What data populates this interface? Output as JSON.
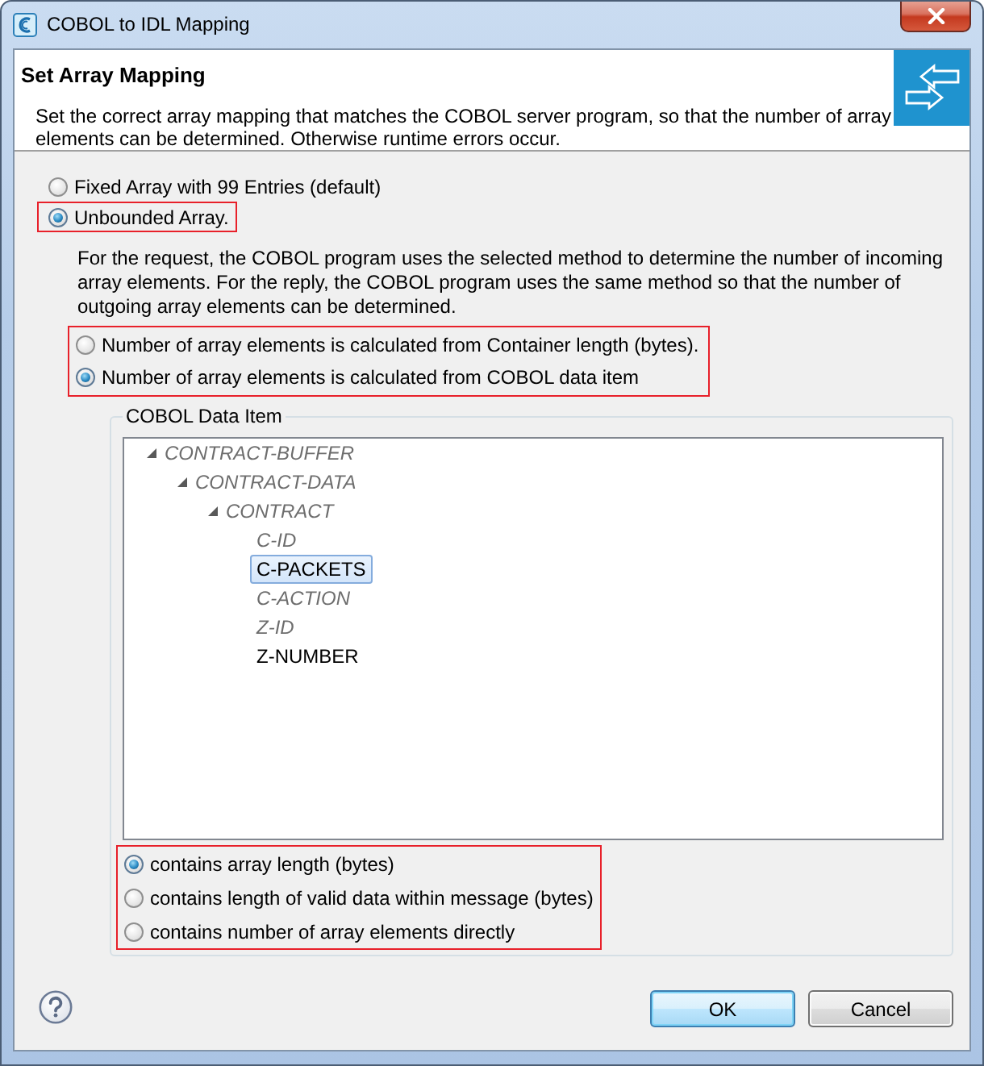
{
  "window": {
    "title": "COBOL to IDL Mapping"
  },
  "header": {
    "title": "Set Array Mapping",
    "description": "Set the correct array mapping that matches the COBOL server program, so that the number of array elements can be determined. Otherwise runtime errors occur."
  },
  "array_types": [
    {
      "label": "Fixed Array with 99 Entries (default)",
      "selected": false,
      "highlighted": false
    },
    {
      "label": "Unbounded Array.",
      "selected": true,
      "highlighted": true
    }
  ],
  "array_description": "For the request, the COBOL program uses the selected method to determine the number of incoming array elements. For the reply, the COBOL program uses the same method so that the number of outgoing array elements can be determined.",
  "length_source": {
    "highlighted": true,
    "options": [
      {
        "label": "Number of array elements is calculated from Container length (bytes).",
        "selected": false
      },
      {
        "label": "Number of array elements is calculated from COBOL data item",
        "selected": true
      }
    ]
  },
  "cobol_data_item": {
    "title": "COBOL Data Item",
    "tree": [
      {
        "label": "CONTRACT-BUFFER",
        "disabled": true,
        "selected": false,
        "expanded": true,
        "children": [
          {
            "label": "CONTRACT-DATA",
            "disabled": true,
            "selected": false,
            "expanded": true,
            "children": [
              {
                "label": "CONTRACT",
                "disabled": true,
                "selected": false,
                "expanded": true,
                "children": [
                  {
                    "label": "C-ID",
                    "disabled": true,
                    "selected": false
                  },
                  {
                    "label": "C-PACKETS",
                    "disabled": false,
                    "selected": true
                  },
                  {
                    "label": "C-ACTION",
                    "disabled": true,
                    "selected": false
                  },
                  {
                    "label": "Z-ID",
                    "disabled": true,
                    "selected": false
                  },
                  {
                    "label": "Z-NUMBER",
                    "disabled": false,
                    "selected": false
                  }
                ]
              }
            ]
          }
        ]
      }
    ],
    "usage": {
      "highlighted": true,
      "options": [
        {
          "label": "contains array length (bytes)",
          "selected": true
        },
        {
          "label": "contains length of valid data within message (bytes)",
          "selected": false
        },
        {
          "label": "contains number of array elements directly",
          "selected": false
        }
      ]
    }
  },
  "buttons": [
    {
      "label": "OK",
      "default": true
    },
    {
      "label": "Cancel",
      "default": false
    }
  ]
}
